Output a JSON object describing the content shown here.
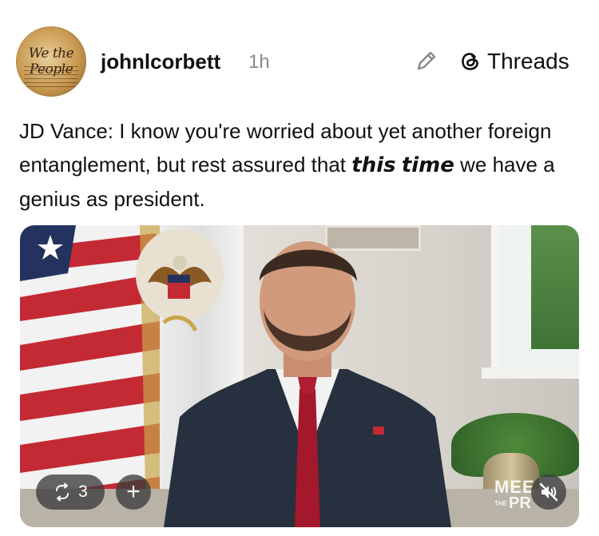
{
  "post": {
    "author": "johnlcorbett",
    "time": "1h",
    "avatar_text": "We the People",
    "text_part1": "JD Vance: I know you're worried about yet another foreign entanglement, but rest assured that ",
    "text_em1": "this",
    "text_part2": " ",
    "text_em2": "time",
    "text_part3": " we have a genius as president."
  },
  "header": {
    "app_name": "Threads",
    "edit_icon": "pencil-icon",
    "logo_icon": "threads-logo-icon"
  },
  "media": {
    "repost_count": "3",
    "add_label": "+",
    "watermark_line1": "MEE",
    "watermark_the": "THE",
    "watermark_line2": "PR",
    "mute_icon": "muted-speaker-icon",
    "repost_icon": "repost-icon"
  },
  "colors": {
    "text": "#111111",
    "muted": "#8a8a8a",
    "overlay": "#3c3c3c"
  }
}
